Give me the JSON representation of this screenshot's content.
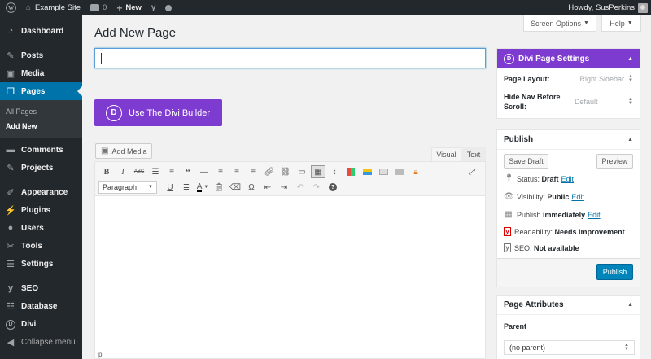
{
  "adminbar": {
    "site_name": "Example Site",
    "comments_count": "0",
    "new_label": "New",
    "greeting": "Howdy, SusPerkins"
  },
  "sidebar": {
    "items": [
      {
        "label": "Dashboard",
        "icon": "dashboard-icon"
      },
      {
        "label": "Posts",
        "icon": "pin-icon"
      },
      {
        "label": "Media",
        "icon": "media-icon"
      },
      {
        "label": "Pages",
        "icon": "pages-icon"
      },
      {
        "label": "Comments",
        "icon": "comment-icon"
      },
      {
        "label": "Projects",
        "icon": "pin-icon"
      },
      {
        "label": "Appearance",
        "icon": "brush-icon"
      },
      {
        "label": "Plugins",
        "icon": "plug-icon"
      },
      {
        "label": "Users",
        "icon": "users-icon"
      },
      {
        "label": "Tools",
        "icon": "wrench-icon"
      },
      {
        "label": "Settings",
        "icon": "sliders-icon"
      },
      {
        "label": "SEO",
        "icon": "yoast-icon"
      },
      {
        "label": "Database",
        "icon": "database-icon"
      },
      {
        "label": "Divi",
        "icon": "divi-icon"
      },
      {
        "label": "Collapse menu",
        "icon": "collapse-icon"
      }
    ],
    "submenu": [
      "All Pages",
      "Add New"
    ]
  },
  "screen_options_label": "Screen Options",
  "help_label": "Help",
  "page_title": "Add New Page",
  "title_input_value": "",
  "divi_button_label": "Use The Divi Builder",
  "editor": {
    "add_media_label": "Add Media",
    "tab_visual": "Visual",
    "tab_text": "Text",
    "format_select": "Paragraph",
    "path": "p"
  },
  "divi_settings": {
    "title": "Divi Page Settings",
    "page_layout_label": "Page Layout:",
    "page_layout_value": "Right Sidebar",
    "hide_nav_label": "Hide Nav Before Scroll:",
    "hide_nav_value": "Default"
  },
  "publish": {
    "title": "Publish",
    "save_draft": "Save Draft",
    "preview": "Preview",
    "status_label": "Status:",
    "status_value": "Draft",
    "visibility_label": "Visibility:",
    "visibility_value": "Public",
    "publish_label": "Publish",
    "publish_value": "immediately",
    "readability_label": "Readability:",
    "readability_value": "Needs improvement",
    "seo_label": "SEO:",
    "seo_value": "Not available",
    "edit": "Edit",
    "publish_button": "Publish"
  },
  "page_attributes": {
    "title": "Page Attributes",
    "parent_label": "Parent",
    "parent_value": "(no parent)"
  },
  "colors": {
    "admin_bar": "#23282d",
    "accent_blue": "#0073aa",
    "divi_purple": "#7e3bd0"
  }
}
